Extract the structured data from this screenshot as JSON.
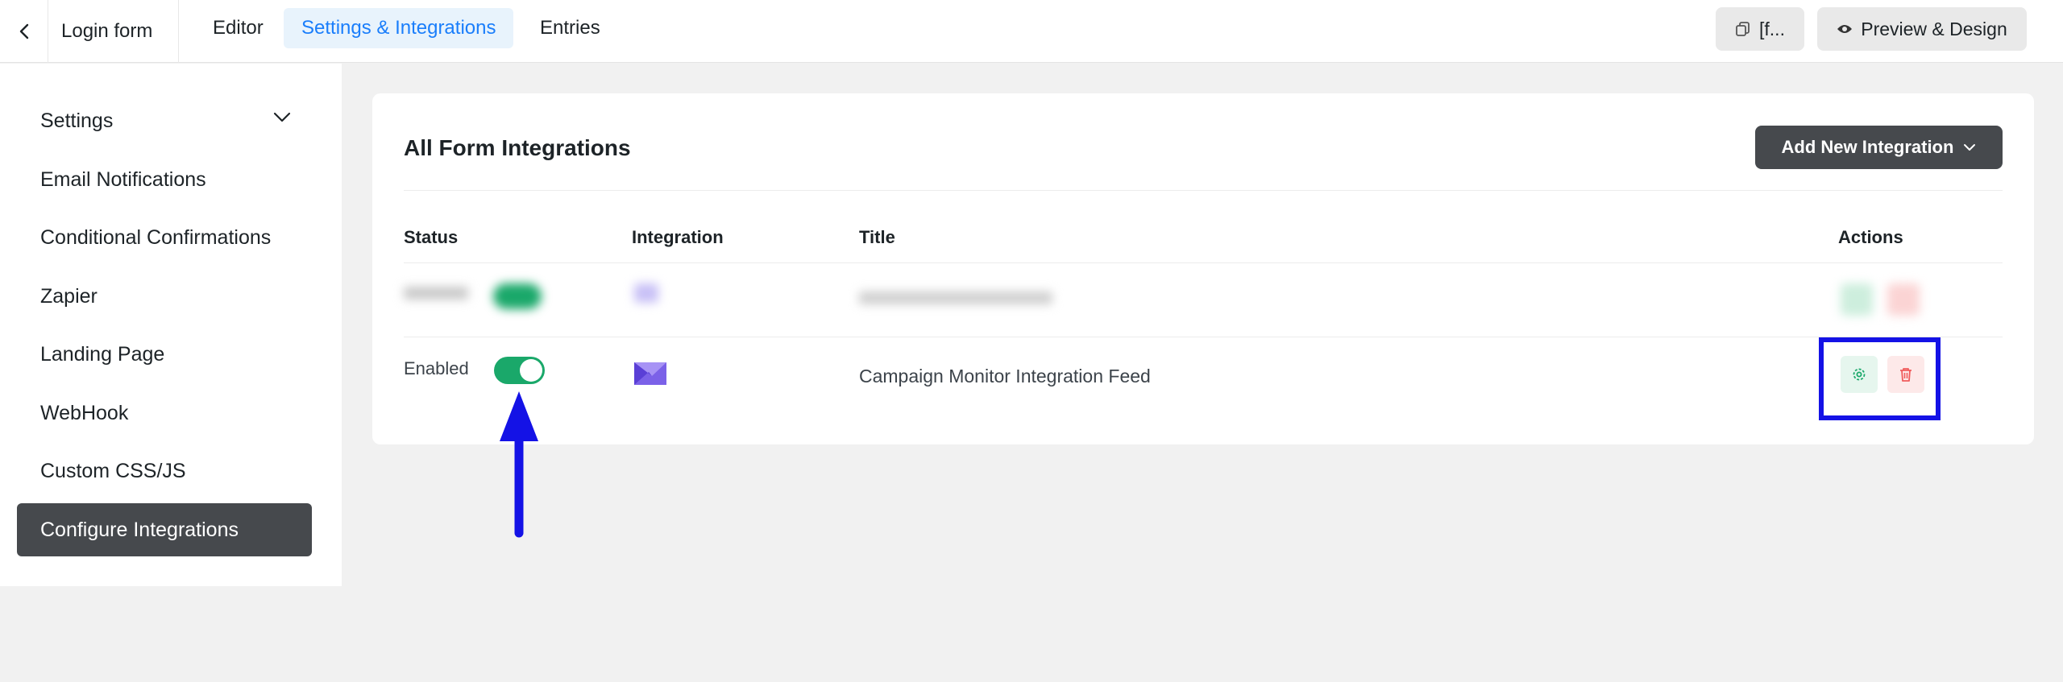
{
  "topbar": {
    "form_name": "Login form",
    "tabs": [
      {
        "label": "Editor"
      },
      {
        "label": "Settings & Integrations",
        "active": true
      },
      {
        "label": "Entries"
      }
    ],
    "shortcode_label": "[f...",
    "preview_label": "Preview & Design"
  },
  "sidebar": {
    "items": [
      {
        "label": "Settings"
      },
      {
        "label": "Email Notifications"
      },
      {
        "label": "Conditional Confirmations"
      },
      {
        "label": "Zapier"
      },
      {
        "label": "Landing Page"
      },
      {
        "label": "WebHook"
      },
      {
        "label": "Custom CSS/JS"
      },
      {
        "label": "Configure Integrations",
        "active": true
      }
    ]
  },
  "main": {
    "title": "All Form Integrations",
    "add_button_label": "Add New Integration",
    "columns": [
      "Status",
      "Integration",
      "Title",
      "Actions"
    ],
    "rows": [
      {
        "status": "Enabled",
        "enabled": true,
        "integration_icon": "campaign-monitor-icon",
        "title": "Campaign Monitor Integration Feed"
      }
    ]
  },
  "colors": {
    "accent": "#1a7efb",
    "toggle_on": "#1aa86a",
    "dark_button": "#46494d",
    "annotation": "#1412e6"
  }
}
